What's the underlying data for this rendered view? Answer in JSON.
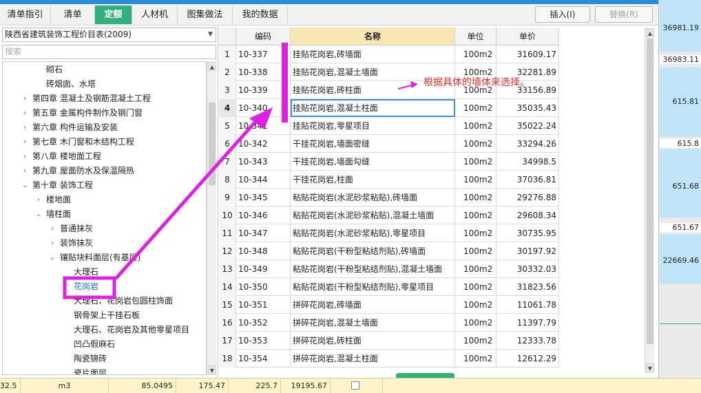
{
  "tabs": [
    "清单指引",
    "清单",
    "定额",
    "人材机",
    "图集做法",
    "我的数据"
  ],
  "buttons": {
    "insert": "插入(I)",
    "replace": "替换(R)"
  },
  "left": {
    "select_value": "陕西省建筑装饰工程价目表(2009)",
    "search_placeholder": "搜索",
    "tree": [
      "砌石",
      "砖烟囱、水塔",
      "第四章 混凝土及钢筋混凝土工程",
      "第五章 金属构件制作及钢门窗",
      "第六章 构件运输及安装",
      "第七章 木门窗和木结构工程",
      "第八章 楼地面工程",
      "第九章 屋面防水及保温隔热",
      "第十章 装饰工程",
      "楼地面",
      "墙柱面",
      "普通抹灰",
      "装饰抹灰",
      "镶贴块料面层(有基层)",
      "大理石",
      "花岗岩",
      "大理石、花岗岩包圆柱饰面",
      "钢骨架上干挂石板",
      "大理石、花岗岩及其他零星项目",
      "凹凸假麻石",
      "陶瓷锦砖",
      "瓷片面层"
    ]
  },
  "grid": {
    "headers": {
      "code": "编码",
      "name": "名称",
      "unit": "单位",
      "price": "单价"
    },
    "rows": [
      {
        "idx": "1",
        "code": "10-337",
        "name": "挂贴花岗岩,砖墙面",
        "unit": "100m2",
        "price": "31609.17"
      },
      {
        "idx": "2",
        "code": "10-338",
        "name": "挂贴花岗岩,混凝土墙面",
        "unit": "100m2",
        "price": "32281.89"
      },
      {
        "idx": "3",
        "code": "10-339",
        "name": "挂贴花岗岩,砖柱面",
        "unit": "100m2",
        "price": "33156.89"
      },
      {
        "idx": "4",
        "code": "10-340",
        "name": "挂贴花岗岩,混凝土柱面",
        "unit": "100m2",
        "price": "35035.43"
      },
      {
        "idx": "5",
        "code": "10-341",
        "name": "挂贴花岗岩,零星项目",
        "unit": "100m2",
        "price": "35022.24"
      },
      {
        "idx": "6",
        "code": "10-342",
        "name": "干挂花岗岩,墙面密缝",
        "unit": "100m2",
        "price": "33294.26"
      },
      {
        "idx": "7",
        "code": "10-343",
        "name": "干挂花岗岩,墙面勾缝",
        "unit": "100m2",
        "price": "34998.5"
      },
      {
        "idx": "8",
        "code": "10-344",
        "name": "干挂花岗岩,柱面",
        "unit": "100m2",
        "price": "37036.81"
      },
      {
        "idx": "9",
        "code": "10-345",
        "name": "粘贴花岗岩(水泥砂浆粘贴),砖墙面",
        "unit": "100m2",
        "price": "29276.88"
      },
      {
        "idx": "10",
        "code": "10-346",
        "name": "粘贴花岗岩(水泥砂浆粘贴),混凝土墙面",
        "unit": "100m2",
        "price": "29608.34"
      },
      {
        "idx": "11",
        "code": "10-347",
        "name": "粘贴花岗岩(水泥砂浆粘贴),零星项目",
        "unit": "100m2",
        "price": "30735.95"
      },
      {
        "idx": "12",
        "code": "10-348",
        "name": "粘贴花岗岩(干粉型粘结剂贴),砖墙面",
        "unit": "100m2",
        "price": "30197.92"
      },
      {
        "idx": "13",
        "code": "10-349",
        "name": "粘贴花岗岩(干粉型粘结剂贴),混凝土墙面",
        "unit": "100m2",
        "price": "30332.03"
      },
      {
        "idx": "14",
        "code": "10-350",
        "name": "粘贴花岗岩(干粉型粘结剂贴),零星项目",
        "unit": "100m2",
        "price": "31823.56"
      },
      {
        "idx": "15",
        "code": "10-351",
        "name": "拼碎花岗岩,砖墙面",
        "unit": "100m2",
        "price": "11061.78"
      },
      {
        "idx": "16",
        "code": "10-352",
        "name": "拼碎花岗岩,混凝土墙面",
        "unit": "100m2",
        "price": "11397.79"
      },
      {
        "idx": "17",
        "code": "10-353",
        "name": "拼碎花岗岩,砖柱面",
        "unit": "100m2",
        "price": "12333.78"
      },
      {
        "idx": "18",
        "code": "10-354",
        "name": "拼碎花岗岩,混凝土柱面",
        "unit": "100m2",
        "price": "12612.29"
      }
    ]
  },
  "annotation": "根据具体的墙体来选择。",
  "right_values": [
    "36981.19",
    "36983.11",
    "615.81",
    "615.8",
    "651.68",
    "651.67",
    "22669.46"
  ],
  "bottom": [
    "32.5",
    "m3",
    "85.0495",
    "175.47",
    "225.7",
    "19195.67"
  ],
  "colors": {
    "accent_green": "#2fb07c",
    "annotation_magenta": "#e020e0",
    "annotation_red": "#e8302b"
  }
}
